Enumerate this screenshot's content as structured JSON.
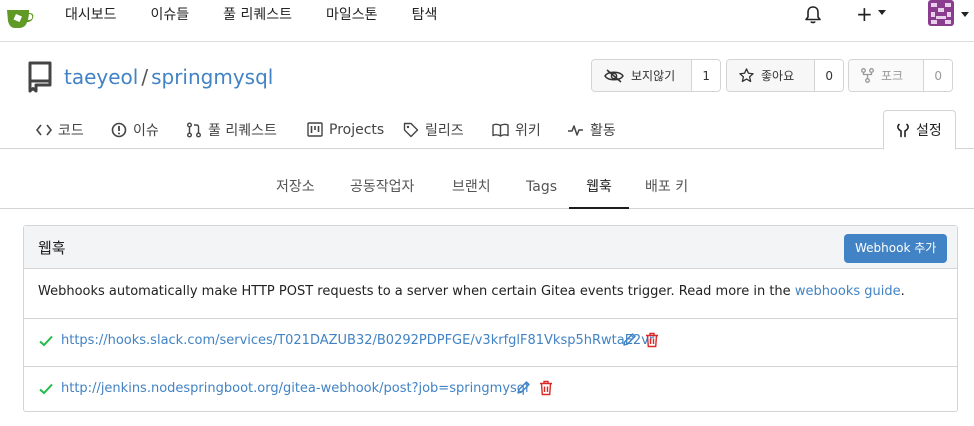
{
  "nav": {
    "links": [
      "대시보드",
      "이슈들",
      "풀 리퀘스트",
      "마일스톤",
      "탐색"
    ],
    "plus": "+"
  },
  "repo": {
    "owner": "taeyeol",
    "separator": "/",
    "name": "springmysql",
    "watch": {
      "label": "보지않기",
      "count": "1"
    },
    "star": {
      "label": "좋아요",
      "count": "0"
    },
    "fork": {
      "label": "포크",
      "count": "0"
    }
  },
  "repo_tabs": [
    {
      "label": "코드",
      "icon": "code-icon"
    },
    {
      "label": "이슈",
      "icon": "issue-icon"
    },
    {
      "label": "풀 리퀘스트",
      "icon": "pull-request-icon"
    },
    {
      "label": "Projects",
      "icon": "project-icon"
    },
    {
      "label": "릴리즈",
      "icon": "tag-icon"
    },
    {
      "label": "위키",
      "icon": "book-icon"
    },
    {
      "label": "활동",
      "icon": "pulse-icon"
    },
    {
      "label": "설정",
      "icon": "tools-icon"
    }
  ],
  "settings_tabs": [
    "저장소",
    "공동작업자",
    "브랜치",
    "Tags",
    "웹훅",
    "배포 키"
  ],
  "settings_active": "웹훅",
  "webhooks": {
    "title": "웹훅",
    "add_button": "Webhook 추가",
    "description": "Webhooks automatically make HTTP POST requests to a server when certain Gitea events trigger. Read more in the ",
    "guide_link": "webhooks guide",
    "description_end": ".",
    "items": [
      {
        "url": "https://hooks.slack.com/services/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",
        "status": "ok"
      },
      {
        "url": "http://jenkins.nodespringboot.org/gitea-webhook/post?job=springmysql",
        "status": "ok"
      }
    ]
  },
  "colors": {
    "link": "#4183c4",
    "primary_button": "#4183c4",
    "success": "#21ba45",
    "danger": "#db2828",
    "gitea_green": "#609926"
  }
}
